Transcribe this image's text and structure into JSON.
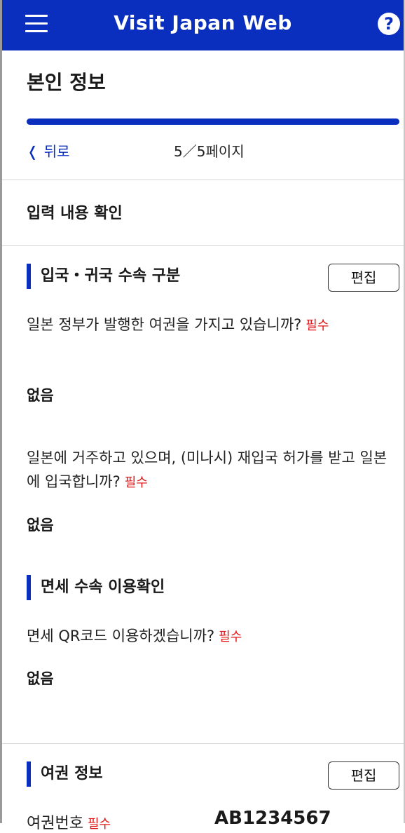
{
  "header": {
    "title": "Visit Japan Web",
    "menu_icon": "hamburger-menu-icon",
    "help_icon": "question-circle-icon",
    "help_glyph": "?",
    "color": "#0a2fbf"
  },
  "page": {
    "heading": "본인 정보",
    "progress_fraction": 1.0,
    "back_label": "뒤로",
    "counter": "5／5페이지"
  },
  "confirm": {
    "title": "입력 내용 확인"
  },
  "sections": [
    {
      "title": "입국・귀국 수속 구분",
      "edit_label": "편집",
      "questions": [
        {
          "text": "일본 정부가 발행한 여권을 가지고 있습니까?",
          "required": "필수",
          "answer": "없음"
        },
        {
          "text": "일본에 거주하고 있으며, (미나시) 재입국 허가를 받고 일본에 입국합니까?",
          "required": "필수",
          "answer": "없음"
        }
      ]
    },
    {
      "title": "면세 수속 이용확인",
      "questions": [
        {
          "text": "면세 QR코드 이용하겠습니까?",
          "required": "필수",
          "answer": "없음"
        }
      ]
    },
    {
      "title": "여권 정보",
      "edit_label": "편집",
      "fields": [
        {
          "label": "여권번호",
          "required": "필수",
          "value": "AB1234567"
        }
      ]
    }
  ],
  "colors": {
    "accent": "#0a2fbf",
    "required": "#e01818"
  }
}
